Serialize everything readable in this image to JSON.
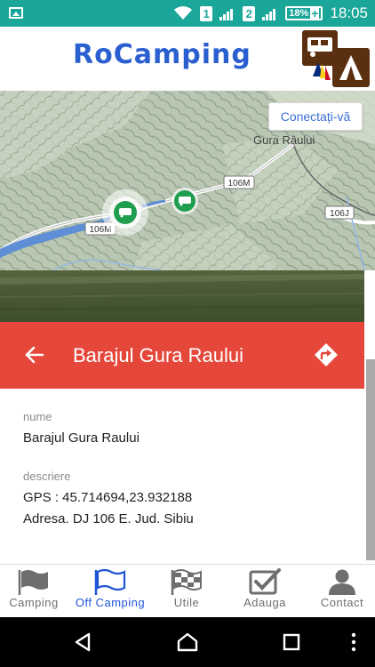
{
  "status_bar": {
    "sim1": "1",
    "sim2": "2",
    "battery": "18%",
    "time": "18:05"
  },
  "app": {
    "title": "RoCamping"
  },
  "map": {
    "connect_button": "Conectați-vă",
    "labels": {
      "place": "Gura Râului",
      "road_1": "106M",
      "road_2": "106M",
      "road_3": "106J"
    }
  },
  "detail": {
    "title": "Barajul Gura Raului",
    "name_label": "nume",
    "name_value": "Barajul Gura Raului",
    "description_label": "descriere",
    "description_line1": "GPS : 45.714694,23.932188",
    "description_line2": "Adresa. DJ 106 E. Jud. Sibiu"
  },
  "bottom_nav": {
    "items": [
      {
        "label": "Camping",
        "icon": "flag-filled-icon",
        "active": false
      },
      {
        "label": "Off Camping",
        "icon": "flag-outline-icon",
        "active": true
      },
      {
        "label": "Utile",
        "icon": "checkered-flag-icon",
        "active": false
      },
      {
        "label": "Adauga",
        "icon": "checkbox-icon",
        "active": false
      },
      {
        "label": "Contact",
        "icon": "person-icon",
        "active": false
      }
    ]
  },
  "colors": {
    "status_bar": "#1aa79a",
    "accent_red": "#e5473b",
    "active_blue": "#1f55d6",
    "marker_green": "#1f9e4f"
  }
}
